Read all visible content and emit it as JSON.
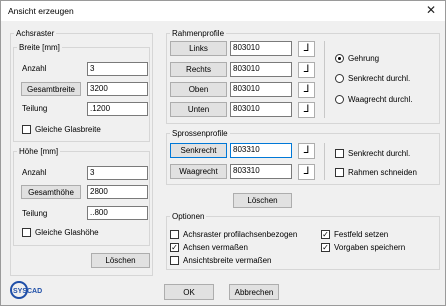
{
  "window": {
    "title": "Ansicht erzeugen",
    "close_icon": "close-x-icon"
  },
  "achsraster": {
    "title": "Achsraster",
    "breite": {
      "title": "Breite [mm]",
      "anzahl_label": "Anzahl",
      "anzahl_value": "3",
      "gesamt_button": "Gesamtbreite",
      "gesamt_value": "3200",
      "teilung_label": "Teilung",
      "teilung_value": ".1200",
      "gleiche_label": "Gleiche Glasbreite",
      "gleiche_checked": false
    },
    "hoehe": {
      "title": "Höhe [mm]",
      "anzahl_label": "Anzahl",
      "anzahl_value": "3",
      "gesamt_button": "Gesamthöhe",
      "gesamt_value": "2800",
      "teilung_label": "Teilung",
      "teilung_value": "..800",
      "gleiche_label": "Gleiche Glashöhe",
      "gleiche_checked": false
    },
    "loeschen_button": "Löschen"
  },
  "rahmenprofile": {
    "title": "Rahmenprofile",
    "rows": [
      {
        "button": "Links",
        "value": "803010"
      },
      {
        "button": "Rechts",
        "value": "803010"
      },
      {
        "button": "Oben",
        "value": "803010"
      },
      {
        "button": "Unten",
        "value": "803010"
      }
    ],
    "profile_icon": "profile-corner-icon",
    "radios": [
      {
        "label": "Gehrung",
        "selected": true
      },
      {
        "label": "Senkrecht durchl.",
        "selected": false
      },
      {
        "label": "Waagrecht durchl.",
        "selected": false
      }
    ]
  },
  "sprossenprofile": {
    "title": "Sprossenprofile",
    "rows": [
      {
        "button": "Senkrecht",
        "value": "803310"
      },
      {
        "button": "Waagrecht",
        "value": "803310"
      }
    ],
    "checks": [
      {
        "label": "Senkrecht durchl.",
        "checked": false
      },
      {
        "label": "Rahmen schneiden",
        "checked": false
      }
    ],
    "loeschen_button": "Löschen"
  },
  "optionen": {
    "title": "Optionen",
    "checks": [
      {
        "label": "Achsraster profilachsenbezogen",
        "checked": false
      },
      {
        "label": "Achsen vermaßen",
        "checked": true
      },
      {
        "label": "Ansichtsbreite vermaßen",
        "checked": false
      },
      {
        "label": "Festfeld setzen",
        "checked": true
      },
      {
        "label": "Vorgaben speichern",
        "checked": true
      }
    ]
  },
  "footer": {
    "logo_text": "SYSCAD",
    "ok_button": "OK",
    "cancel_button": "Abbrechen"
  }
}
